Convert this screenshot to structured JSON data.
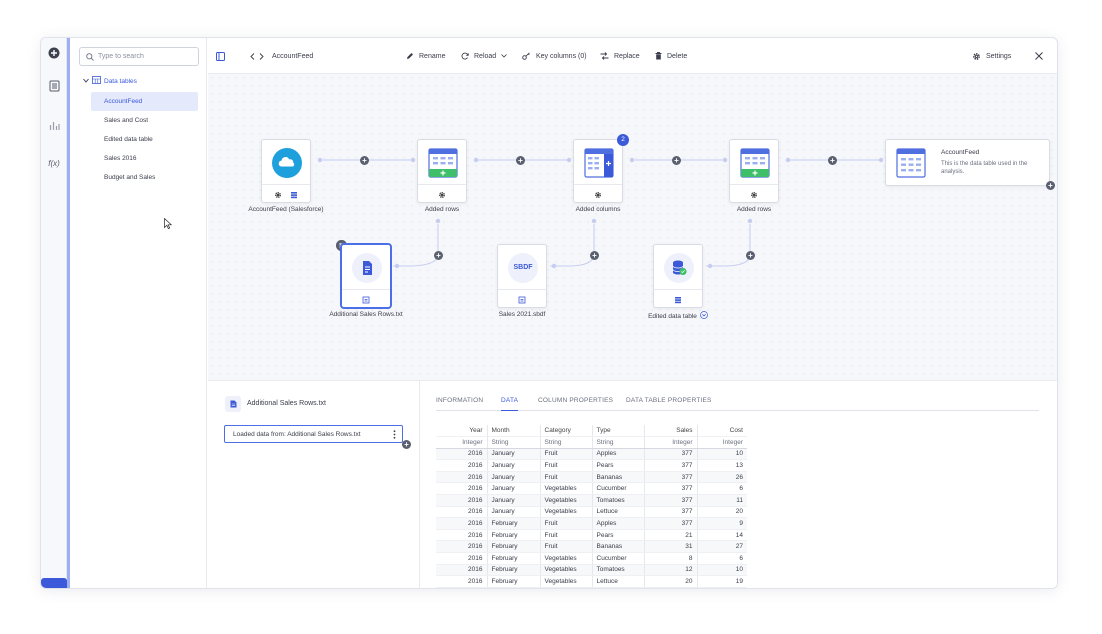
{
  "toolbar": {
    "breadcrumb": "AccountFeed",
    "rename": "Rename",
    "reload": "Reload",
    "key_columns": "Key columns (0)",
    "replace": "Replace",
    "delete": "Delete",
    "settings": "Settings"
  },
  "sidebar": {
    "search_placeholder": "Type to search",
    "root_label": "Data tables",
    "items": [
      {
        "label": "AccountFeed"
      },
      {
        "label": "Sales and Cost"
      },
      {
        "label": "Edited data table"
      },
      {
        "label": "Sales 2016"
      },
      {
        "label": "Budget and Sales"
      }
    ]
  },
  "canvas": {
    "nodes": {
      "source_label": "AccountFeed (Salesforce)",
      "added_rows_1": "Added rows",
      "added_columns": "Added columns",
      "added_columns_badge": "2",
      "added_rows_2": "Added rows",
      "additional_label": "Additional Sales Rows.txt",
      "sbdf_label": "Sales 2021.sbdf",
      "sbdf_text": "SBDF",
      "edited_label": "Edited data table",
      "result_title": "AccountFeed",
      "result_desc": "This is the data table used in the analysis."
    }
  },
  "details": {
    "title": "Additional Sales Rows.txt",
    "step_label": "Loaded data from: Additional Sales Rows.txt",
    "tabs": [
      "INFORMATION",
      "DATA",
      "COLUMN PROPERTIES",
      "DATA TABLE PROPERTIES"
    ],
    "columns": [
      "Year",
      "Month",
      "Category",
      "Type",
      "Sales",
      "Cost"
    ],
    "types": [
      "Integer",
      "String",
      "String",
      "String",
      "Integer",
      "Integer"
    ],
    "rows": [
      [
        "2016",
        "January",
        "Fruit",
        "Apples",
        "377",
        "10"
      ],
      [
        "2016",
        "January",
        "Fruit",
        "Pears",
        "377",
        "13"
      ],
      [
        "2016",
        "January",
        "Fruit",
        "Bananas",
        "377",
        "26"
      ],
      [
        "2016",
        "January",
        "Vegetables",
        "Cucumber",
        "377",
        "6"
      ],
      [
        "2016",
        "January",
        "Vegetables",
        "Tomatoes",
        "377",
        "11"
      ],
      [
        "2016",
        "January",
        "Vegetables",
        "Lettuce",
        "377",
        "20"
      ],
      [
        "2016",
        "February",
        "Fruit",
        "Apples",
        "377",
        "9"
      ],
      [
        "2016",
        "February",
        "Fruit",
        "Pears",
        "21",
        "14"
      ],
      [
        "2016",
        "February",
        "Fruit",
        "Bananas",
        "31",
        "27"
      ],
      [
        "2016",
        "February",
        "Vegetables",
        "Cucumber",
        "8",
        "6"
      ],
      [
        "2016",
        "February",
        "Vegetables",
        "Tomatoes",
        "12",
        "10"
      ],
      [
        "2016",
        "February",
        "Vegetables",
        "Lettuce",
        "20",
        "19"
      ]
    ]
  },
  "colors": {
    "accent": "#3b59d9",
    "green": "#3fbf6a",
    "cloud": "#1ea0dd"
  }
}
